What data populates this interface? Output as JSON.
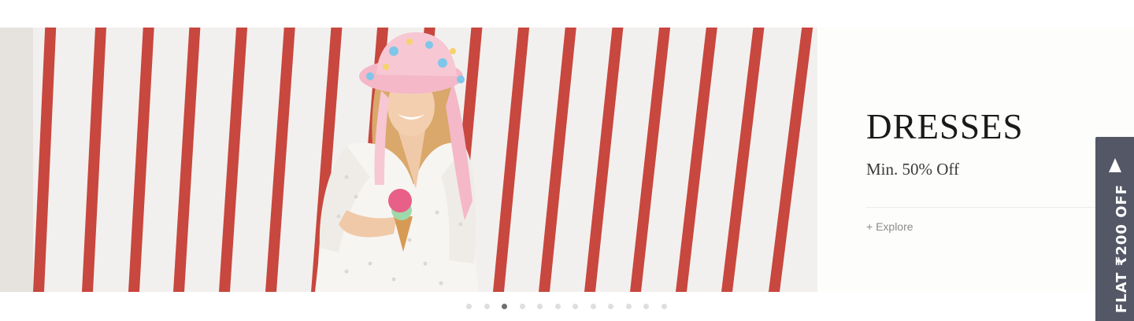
{
  "slide": {
    "title": "DRESSES",
    "subtitle": "Min. 50% Off",
    "cta": "+ Explore",
    "image": "woman-in-floral-bucket-hat-with-ice-cream"
  },
  "carousel": {
    "total_slides": 12,
    "active_index": 2
  },
  "offer_tab": {
    "text": "FLAT ₹200 OFF",
    "icon": "triangle-up-icon"
  },
  "colors": {
    "stripe_red": "#c8473e",
    "wall_white": "#f2f0ee",
    "offer_bg": "#535766",
    "dot_active": "#6f6f6f",
    "dot_inactive": "#dedede"
  }
}
